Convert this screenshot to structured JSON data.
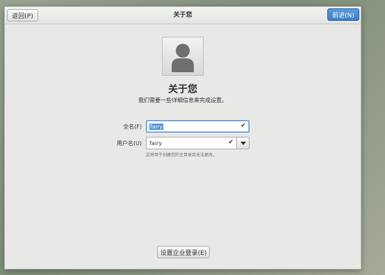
{
  "header": {
    "back_label": "返回(P)",
    "title": "关于您",
    "next_label": "前进(N)",
    "next_color": "#3a7ec6"
  },
  "avatar": {
    "icon": "user-silhouette-icon"
  },
  "main": {
    "title": "关于您",
    "subtitle": "我们需要一些详细信息来完成设置。"
  },
  "form": {
    "fullname_label": "全名(F)",
    "fullname_value": "fairy",
    "username_label": "用户名(U)",
    "username_value": "fairy",
    "hint": "这将用于创建您的主目录且无法更改。",
    "check_icon": "checkmark-icon",
    "dropdown_icon": "chevron-down-icon"
  },
  "footer": {
    "enterprise_login_label": "设置企业登录(E)"
  }
}
